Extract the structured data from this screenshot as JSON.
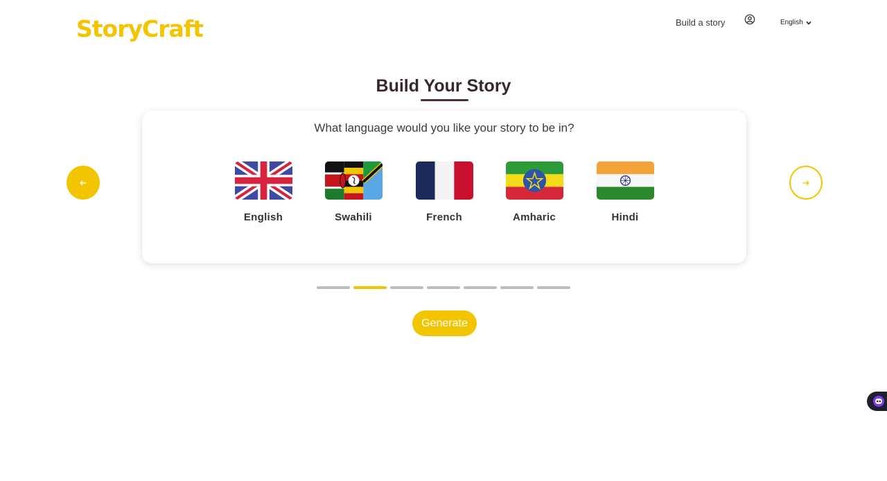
{
  "brand": {
    "logo_text": "StoryCraft",
    "color": "#f3c400"
  },
  "nav": {
    "build_story": "Build a story",
    "user_icon": "user-circle-icon",
    "language_selected": "English"
  },
  "page": {
    "title": "Build Your Story",
    "question": "What language would you like your story to be in?"
  },
  "languages": [
    {
      "label": "English",
      "flag": "uk-flag-icon"
    },
    {
      "label": "Swahili",
      "flag": "swahili-flag-icon"
    },
    {
      "label": "French",
      "flag": "france-flag-icon"
    },
    {
      "label": "Amharic",
      "flag": "ethiopia-flag-icon"
    },
    {
      "label": "Hindi",
      "flag": "india-flag-icon"
    }
  ],
  "steps": {
    "total": 7,
    "current": 2
  },
  "actions": {
    "generate": "Generate"
  },
  "colors": {
    "accent": "#f3c400",
    "title": "#3a2630",
    "inactive_step": "#bdbdbd"
  }
}
